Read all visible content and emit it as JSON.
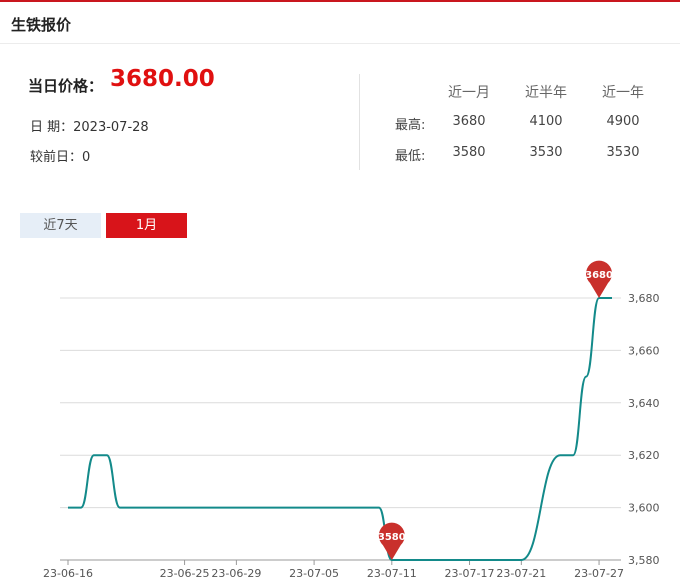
{
  "header": {
    "title": "生铁报价"
  },
  "price": {
    "label": "当日价格：",
    "value": "3680.00"
  },
  "info": {
    "date_label": "日 期：",
    "date_value": "2023-07-28",
    "change_label": "较前日：",
    "change_value": "0"
  },
  "stats": {
    "columns": [
      "近一月",
      "近半年",
      "近一年"
    ],
    "rows": [
      {
        "label": "最高:",
        "values": [
          "3680",
          "4100",
          "4900"
        ]
      },
      {
        "label": "最低:",
        "values": [
          "3580",
          "3530",
          "3530"
        ]
      }
    ]
  },
  "tabs": [
    {
      "label": "近7天",
      "active": false
    },
    {
      "label": "1月",
      "active": true
    }
  ],
  "colors": {
    "accent": "#d8141a",
    "line": "#138a8a",
    "marker": "#c9302c",
    "price": "#e01010"
  },
  "chart_data": {
    "type": "line",
    "title": "",
    "xlabel": "",
    "ylabel": "",
    "ylim": [
      3580,
      3680
    ],
    "yticks": [
      3580,
      3600,
      3620,
      3640,
      3660,
      3680
    ],
    "ytick_labels": [
      "3,580",
      "3,600",
      "3,620",
      "3,640",
      "3,660",
      "3,680"
    ],
    "xtick_labels": [
      "23-06-16",
      "23-06-25",
      "23-06-29",
      "23-07-05",
      "23-07-11",
      "23-07-17",
      "23-07-21",
      "23-07-27"
    ],
    "grid": true,
    "series": [
      {
        "x": [
          "2023-06-16",
          "2023-06-17",
          "2023-06-18",
          "2023-06-19",
          "2023-06-20",
          "2023-06-21",
          "2023-06-22",
          "2023-06-25",
          "2023-06-26",
          "2023-06-27",
          "2023-06-28",
          "2023-06-29",
          "2023-06-30",
          "2023-07-03",
          "2023-07-04",
          "2023-07-05",
          "2023-07-06",
          "2023-07-07",
          "2023-07-10",
          "2023-07-11",
          "2023-07-12",
          "2023-07-13",
          "2023-07-14",
          "2023-07-17",
          "2023-07-18",
          "2023-07-19",
          "2023-07-20",
          "2023-07-21",
          "2023-07-24",
          "2023-07-25",
          "2023-07-26",
          "2023-07-27",
          "2023-07-28"
        ],
        "values": [
          3600,
          3600,
          3620,
          3620,
          3600,
          3600,
          3600,
          3600,
          3600,
          3600,
          3600,
          3600,
          3600,
          3600,
          3600,
          3600,
          3600,
          3600,
          3600,
          3580,
          3580,
          3580,
          3580,
          3580,
          3580,
          3580,
          3580,
          3580,
          3620,
          3620,
          3650,
          3680,
          3680
        ]
      }
    ],
    "annotations": [
      {
        "x": "2023-07-11",
        "y": 3580,
        "label": "3580"
      },
      {
        "x": "2023-07-27",
        "y": 3680,
        "label": "3680"
      }
    ]
  }
}
